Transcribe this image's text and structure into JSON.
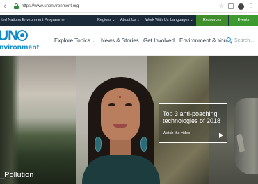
{
  "browser": {
    "back_arrow": "‹",
    "url": "https://www.unenvironment.org",
    "star": "☆",
    "menu": "⋮"
  },
  "topbar": {
    "org_name": "ited Nations Environment Programme",
    "links": [
      {
        "label": "Regions",
        "has_dropdown": true
      },
      {
        "label": "About Us",
        "has_dropdown": true
      },
      {
        "label": "Work With Us",
        "has_dropdown": false
      },
      {
        "label": "Languages",
        "has_dropdown": true
      }
    ],
    "resources": "Resources",
    "events": "Events",
    "chevron": "⌄"
  },
  "header": {
    "logo_letters": "UN",
    "logo_subtitle": "nvironment",
    "nav": [
      {
        "label": "Explore Topics",
        "has_dropdown": true
      },
      {
        "label": "News & Stories",
        "has_dropdown": false
      },
      {
        "label": "Get Involved",
        "has_dropdown": false
      },
      {
        "label": "Environment & You",
        "has_dropdown": false
      }
    ],
    "search_placeholder": "Search..."
  },
  "hero": {
    "promo_title": "Top 3 anti-poaching technologies of 2018",
    "promo_link": "Watch the video",
    "caption": "_Pollution"
  },
  "colors": {
    "brand_blue": "#0d8ac7",
    "topbar_bg": "#1c2b3a",
    "resources_green": "#3f8e2b",
    "events_green": "#3c9a2f"
  },
  "icons": {
    "lock": "lock-icon",
    "search": "search-icon",
    "play": "play-icon",
    "emblem": "un-emblem-icon"
  }
}
